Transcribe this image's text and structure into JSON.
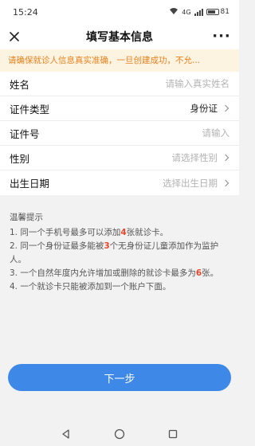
{
  "status": {
    "time": "15:24",
    "signal_label": "4G",
    "battery": "81"
  },
  "nav": {
    "title": "填写基本信息",
    "more": "···"
  },
  "notice": "请确保就诊人信息真实准确，一旦创建成功，不允...",
  "form": {
    "rows": [
      {
        "label": "姓名",
        "value": "请输入真实姓名",
        "placeholder": true,
        "chevron": false
      },
      {
        "label": "证件类型",
        "value": "身份证",
        "placeholder": false,
        "chevron": true
      },
      {
        "label": "证件号",
        "value": "请输入",
        "placeholder": true,
        "chevron": false
      },
      {
        "label": "性别",
        "value": "请选择性别",
        "placeholder": true,
        "chevron": true
      },
      {
        "label": "出生日期",
        "value": "选择出生日期",
        "placeholder": true,
        "chevron": true
      }
    ]
  },
  "tips": {
    "title": "温馨提示",
    "items": [
      {
        "pre": "1. 同一个手机号最多可以添加",
        "hl": "4",
        "post": "张就诊卡。"
      },
      {
        "pre": "2. 同一个身份证最多能被",
        "hl": "3",
        "post": "个无身份证儿童添加作为监护人。"
      },
      {
        "pre": "3. 一个自然年度内允许增加或删除的就诊卡最多为",
        "hl": "6",
        "post": "张。"
      },
      {
        "pre": "4. 一个就诊卡只能被添加到一个账户下面。",
        "hl": "",
        "post": ""
      }
    ]
  },
  "next_button": "下一步"
}
